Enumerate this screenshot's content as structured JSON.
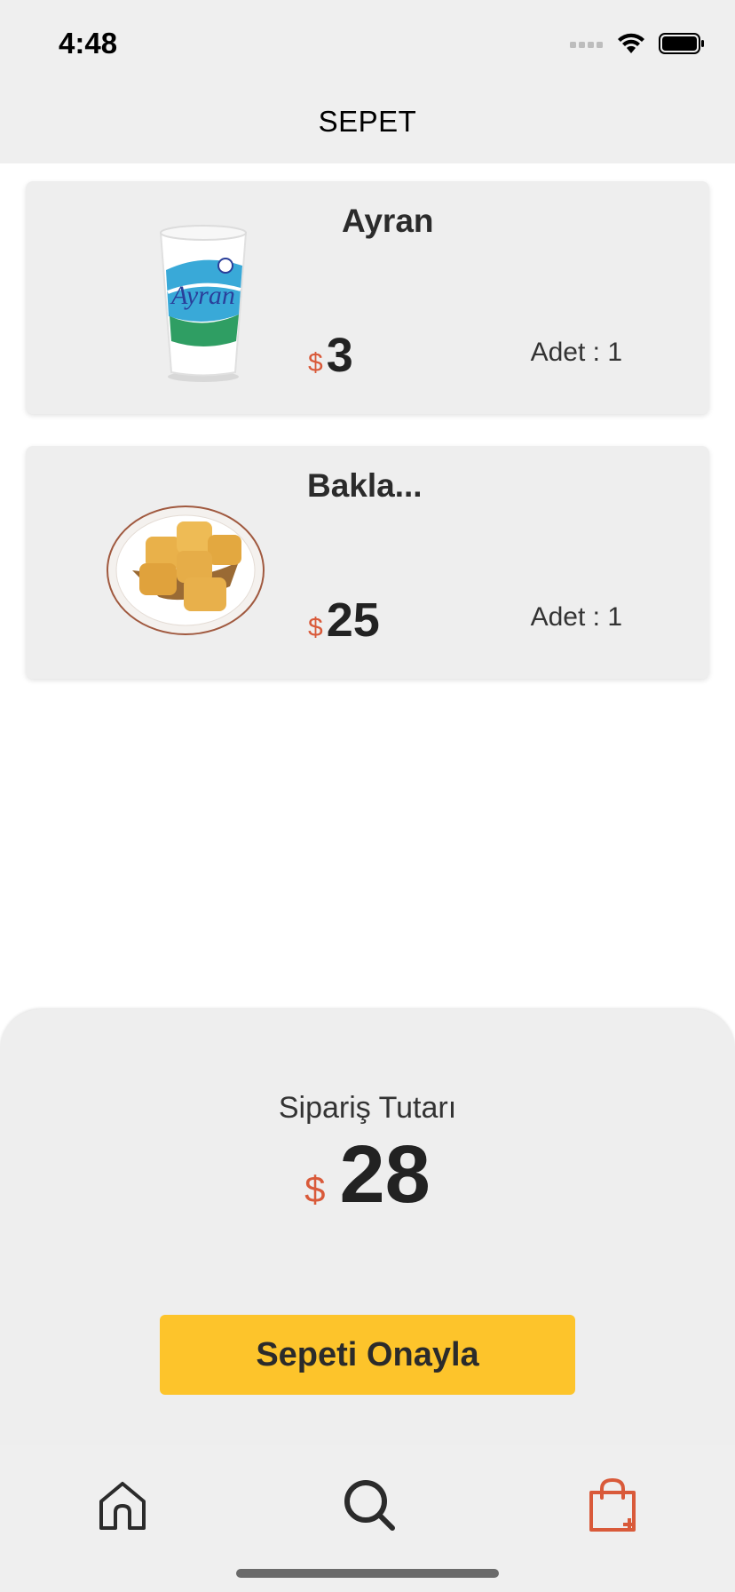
{
  "status_bar": {
    "time": "4:48"
  },
  "header": {
    "title": "SEPET"
  },
  "cart": {
    "items": [
      {
        "name": "Ayran",
        "currency": "$",
        "price": "3",
        "quantity_text": "Adet : 1"
      },
      {
        "name": "Bakla...",
        "currency": "$",
        "price": "25",
        "quantity_text": "Adet : 1"
      }
    ]
  },
  "summary": {
    "label": "Sipariş Tutarı",
    "currency": "$",
    "total": "28",
    "confirm_label": "Sepeti Onayla"
  },
  "tab_bar": {
    "tabs": [
      {
        "icon": "home-icon",
        "active": false
      },
      {
        "icon": "search-icon",
        "active": false
      },
      {
        "icon": "shopping-bag-icon",
        "active": true
      }
    ]
  },
  "colors": {
    "accent": "#d95a3a",
    "button": "#fdc42b",
    "panel": "#eeeeee"
  }
}
